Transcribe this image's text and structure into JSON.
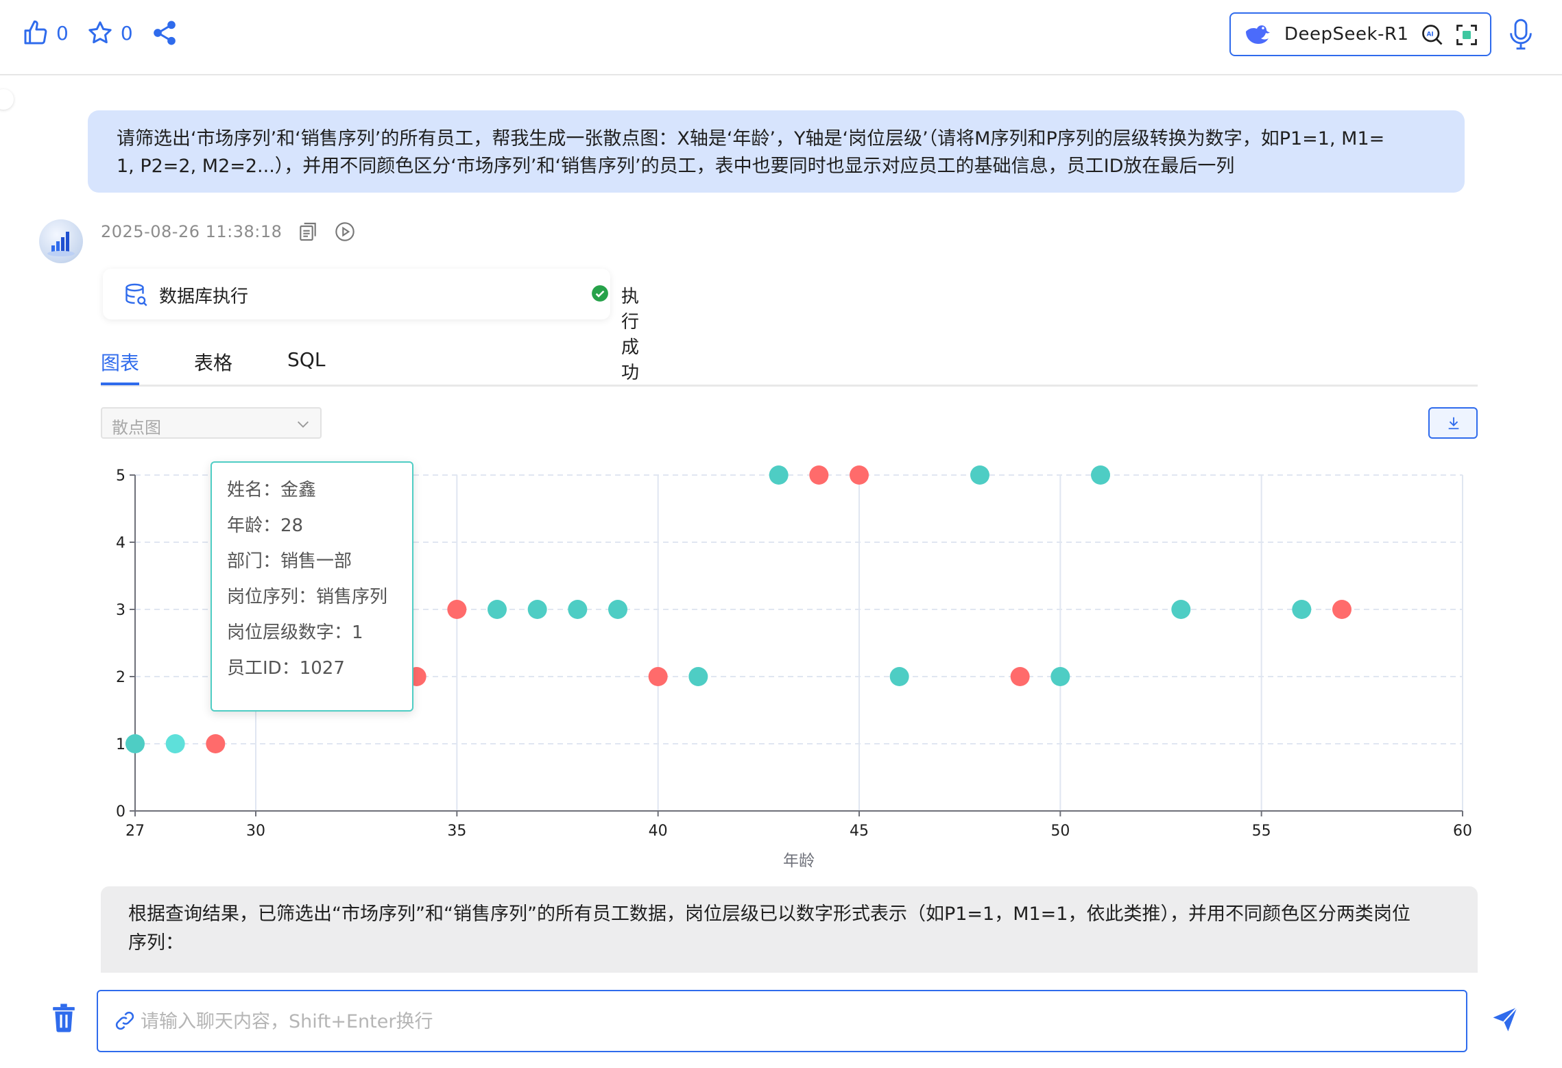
{
  "toolbar": {
    "like_count": "0",
    "star_count": "0"
  },
  "model": {
    "name": "DeepSeek-R1"
  },
  "user_message": {
    "line1": "请筛选出‘市场序列’和‘销售序列’的所有员工，帮我生成一张散点图：X轴是‘年龄’，Y轴是‘岗位层级’（请将M序列和P序列的层级转换为数字，如P1=1, M1=",
    "line2": "1, P2=2, M2=2...），并用不同颜色区分‘市场序列’和‘销售序列’的员工，表中也要同时也显示对应员工的基础信息，员工ID放在最后一列"
  },
  "assistant": {
    "timestamp": "2025-08-26 11:38:18",
    "db_label": "数据库执行",
    "db_status": "执行成功"
  },
  "tabs": [
    {
      "label": "图表"
    },
    {
      "label": "表格"
    },
    {
      "label": "SQL"
    }
  ],
  "chart_type_select": {
    "value": "散点图"
  },
  "chart_data": {
    "type": "scatter",
    "xlabel": "年龄",
    "ylabel": "",
    "xlim": [
      27,
      60
    ],
    "ylim": [
      0,
      5
    ],
    "x_ticks": [
      27,
      30,
      35,
      40,
      45,
      50,
      55,
      60
    ],
    "y_ticks": [
      0,
      1,
      2,
      3,
      4,
      5
    ],
    "colors": {
      "teal": "#4ecdc4",
      "red": "#ff6b6b",
      "highlight": "#5ee0da"
    },
    "points": [
      {
        "x": 27,
        "y": 1,
        "c": "teal"
      },
      {
        "x": 28,
        "y": 1,
        "c": "highlight"
      },
      {
        "x": 29,
        "y": 1,
        "c": "red"
      },
      {
        "x": 34,
        "y": 2,
        "c": "red"
      },
      {
        "x": 35,
        "y": 3,
        "c": "red"
      },
      {
        "x": 36,
        "y": 3,
        "c": "teal"
      },
      {
        "x": 37,
        "y": 3,
        "c": "teal"
      },
      {
        "x": 38,
        "y": 3,
        "c": "teal"
      },
      {
        "x": 39,
        "y": 3,
        "c": "teal"
      },
      {
        "x": 40,
        "y": 2,
        "c": "red"
      },
      {
        "x": 41,
        "y": 2,
        "c": "teal"
      },
      {
        "x": 43,
        "y": 5,
        "c": "teal"
      },
      {
        "x": 44,
        "y": 5,
        "c": "red"
      },
      {
        "x": 45,
        "y": 5,
        "c": "red"
      },
      {
        "x": 46,
        "y": 2,
        "c": "teal"
      },
      {
        "x": 48,
        "y": 5,
        "c": "teal"
      },
      {
        "x": 49,
        "y": 2,
        "c": "red"
      },
      {
        "x": 50,
        "y": 2,
        "c": "teal"
      },
      {
        "x": 51,
        "y": 5,
        "c": "teal"
      },
      {
        "x": 53,
        "y": 3,
        "c": "teal"
      },
      {
        "x": 56,
        "y": 3,
        "c": "teal"
      },
      {
        "x": 57,
        "y": 3,
        "c": "red"
      }
    ]
  },
  "tooltip": {
    "rows": [
      "姓名：金鑫",
      "年龄：28",
      "部门：销售一部",
      "岗位序列：销售序列",
      "岗位层级数字：1",
      "员工ID：1027"
    ]
  },
  "summary": {
    "line1": "根据查询结果，已筛选出“市场序列”和“销售序列”的所有员工数据，岗位层级已以数字形式表示（如P1=1，M1=1，依此类推），并用不同颜色区分两类岗位",
    "line2": "序列："
  },
  "input": {
    "placeholder": "请输入聊天内容，Shift+Enter换行"
  }
}
